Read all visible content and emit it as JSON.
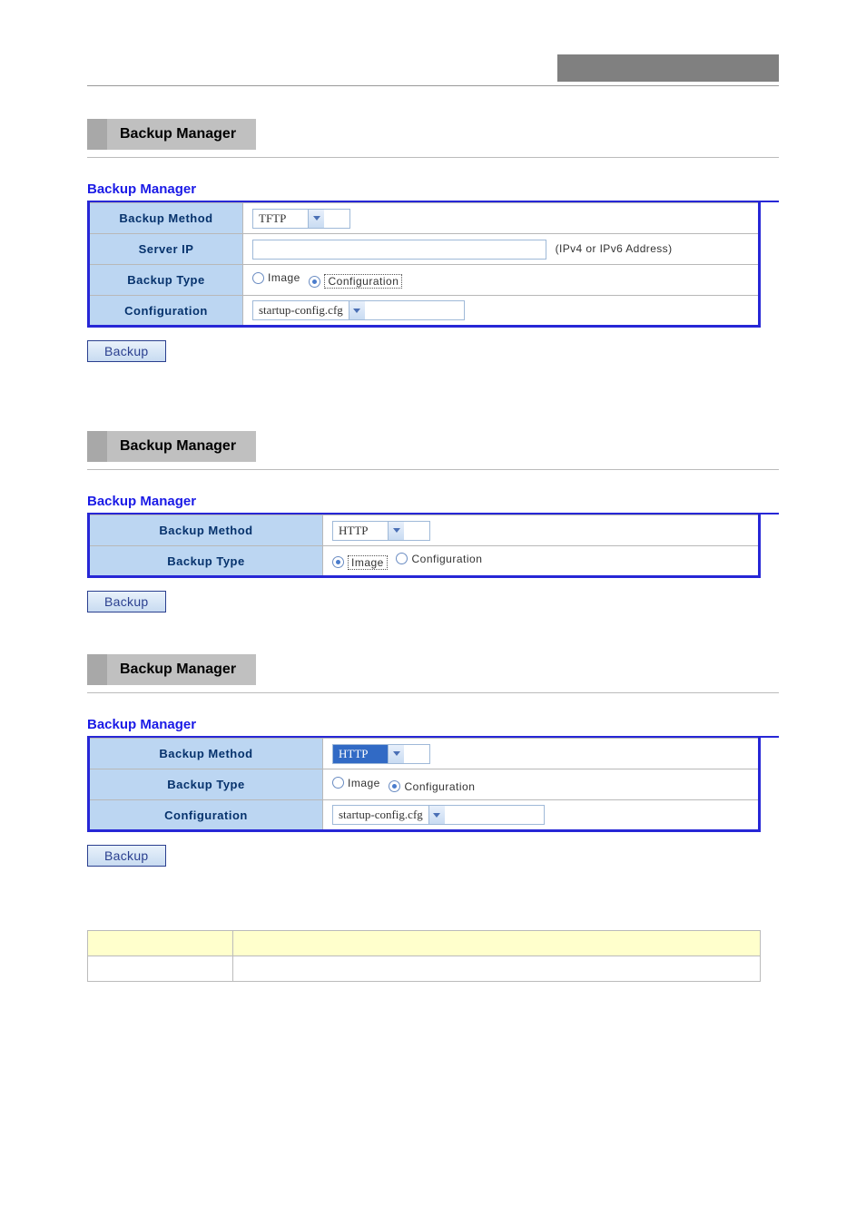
{
  "panels": [
    {
      "tab_title": "Backup Manager",
      "section_title": "Backup Manager",
      "rows": {
        "method_label": "Backup Method",
        "method_value": "TFTP",
        "server_ip_label": "Server IP",
        "server_ip_hint": "(IPv4 or IPv6 Address)",
        "type_label": "Backup Type",
        "type_image": "Image",
        "type_config": "Configuration",
        "config_label": "Configuration",
        "config_value": "startup-config.cfg"
      },
      "button": "Backup"
    },
    {
      "tab_title": "Backup Manager",
      "section_title": "Backup Manager",
      "rows": {
        "method_label": "Backup Method",
        "method_value": "HTTP",
        "type_label": "Backup Type",
        "type_image": "Image",
        "type_config": "Configuration"
      },
      "button": "Backup"
    },
    {
      "tab_title": "Backup Manager",
      "section_title": "Backup Manager",
      "rows": {
        "method_label": "Backup Method",
        "method_value": "HTTP",
        "type_label": "Backup Type",
        "type_image": "Image",
        "type_config": "Configuration",
        "config_label": "Configuration",
        "config_value": "startup-config.cfg"
      },
      "button": "Backup"
    }
  ]
}
